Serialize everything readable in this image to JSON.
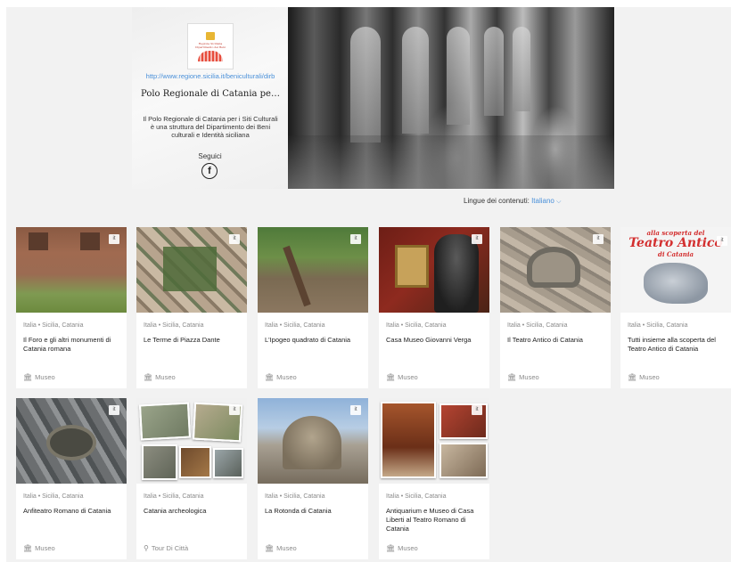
{
  "hero": {
    "url": "http://www.regione.sicilia.it/beniculturali/dirb",
    "title": "Polo Regionale di Catania per i...",
    "description": "Il Polo Regionale di Catania per i Siti Culturali è una struttura del Dipartimento dei Beni culturali e Identità siciliana",
    "follow_label": "Seguici",
    "facebook_glyph": "f",
    "logo_text": "Regione Siciliana Dipartimento dei Beni Culturali"
  },
  "language": {
    "label": "Lingue dei contenuti:",
    "selected": "Italiano",
    "chevron": "⌵"
  },
  "type_icons": {
    "museum": "🏛",
    "tour": "⚲"
  },
  "cards": [
    {
      "badge": "it",
      "country": "Italia",
      "sep": "•",
      "region": "Sicilia, Catania",
      "title": "Il Foro e gli altri monumenti di Catania romana",
      "type": "Museo",
      "icon": "museum-icon"
    },
    {
      "badge": "it",
      "country": "Italia",
      "sep": "•",
      "region": "Sicilia, Catania",
      "title": "Le Terme di Piazza Dante",
      "type": "Museo",
      "icon": "museum-icon"
    },
    {
      "badge": "it",
      "country": "Italia",
      "sep": "•",
      "region": "Sicilia, Catania",
      "title": "L'Ipogeo quadrato di Catania",
      "type": "Museo",
      "icon": "museum-icon"
    },
    {
      "badge": "it",
      "country": "Italia",
      "sep": "•",
      "region": "Sicilia, Catania",
      "title": "Casa Museo Giovanni Verga",
      "type": "Museo",
      "icon": "museum-icon"
    },
    {
      "badge": "it",
      "country": "Italia",
      "sep": "•",
      "region": "Sicilia, Catania",
      "title": "Il Teatro Antico di Catania",
      "type": "Museo",
      "icon": "museum-icon"
    },
    {
      "badge": "it",
      "country": "Italia",
      "sep": "•",
      "region": "Sicilia, Catania",
      "title": "Tutti insieme alla scoperta del Teatro Antico di Catania",
      "type": "Museo",
      "icon": "museum-icon",
      "poster": {
        "line1": "alla scoperta del",
        "line2": "Teatro Antico",
        "line3": "di Catania"
      }
    },
    {
      "badge": "it",
      "country": "Italia",
      "sep": "•",
      "region": "Sicilia, Catania",
      "title": "Anfiteatro Romano di Catania",
      "type": "Museo",
      "icon": "museum-icon"
    },
    {
      "badge": "it",
      "country": "Italia",
      "sep": "•",
      "region": "Sicilia, Catania",
      "title": "Catania archeologica",
      "type": "Tour Di Città",
      "icon": "tour-icon"
    },
    {
      "badge": "it",
      "country": "Italia",
      "sep": "•",
      "region": "Sicilia, Catania",
      "title": "La Rotonda di Catania",
      "type": "Museo",
      "icon": "museum-icon"
    },
    {
      "badge": "it",
      "country": "Italia",
      "sep": "•",
      "region": "Sicilia, Catania",
      "title": "Antiquarium e Museo di Casa Liberti al Teatro Romano di Catania",
      "type": "Museo",
      "icon": "museum-icon"
    }
  ],
  "colors": {
    "accent": "#4a90d9",
    "poster_red": "#d32f2f"
  }
}
